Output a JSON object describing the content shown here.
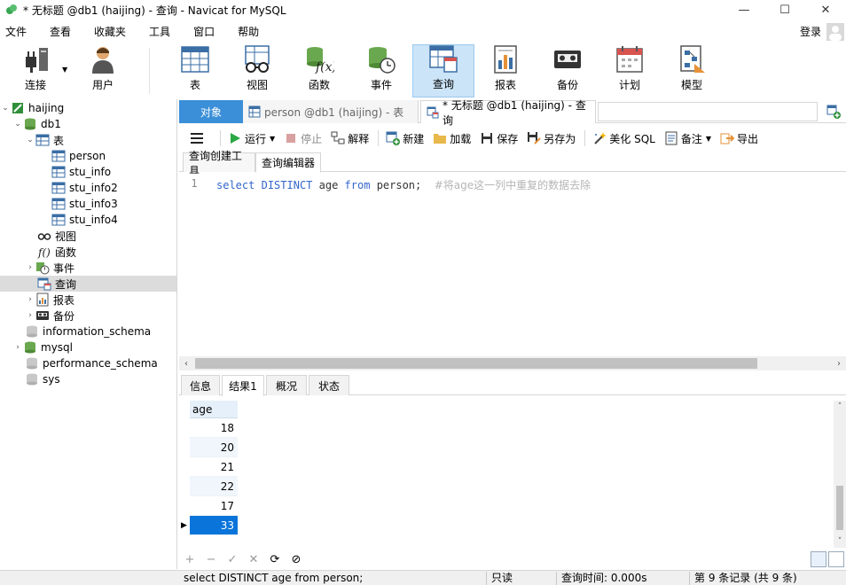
{
  "window": {
    "title": "* 无标题 @db1 (haijing) - 查询 - Navicat for MySQL",
    "minimize": "—",
    "maximize": "☐",
    "close": "✕"
  },
  "menu": {
    "items": [
      "文件",
      "查看",
      "收藏夹",
      "工具",
      "窗口",
      "帮助"
    ],
    "login": "登录"
  },
  "toolbar": {
    "connect": "连接",
    "user": "用户",
    "table": "表",
    "view": "视图",
    "function": "函数",
    "event": "事件",
    "query": "查询",
    "report": "报表",
    "backup": "备份",
    "schedule": "计划",
    "model": "模型"
  },
  "tree": {
    "connection": "haijing",
    "db": "db1",
    "tables_group": "表",
    "tables": [
      "person",
      "stu_info",
      "stu_info2",
      "stu_info3",
      "stu_info4"
    ],
    "views": "视图",
    "functions": "函数",
    "events": "事件",
    "queries": "查询",
    "reports": "报表",
    "backups": "备份",
    "schemas": [
      "information_schema",
      "mysql",
      "performance_schema",
      "sys"
    ]
  },
  "tabs": {
    "objects": "对象",
    "person": "person @db1 (haijing) - 表",
    "query": "* 无标题 @db1 (haijing) - 查询"
  },
  "qtoolbar": {
    "run": "运行",
    "stop": "停止",
    "explain": "解释",
    "new": "新建",
    "load": "加载",
    "save": "保存",
    "save_as": "另存为",
    "beautify": "美化 SQL",
    "note": "备注",
    "export": "导出"
  },
  "subtabs": {
    "builder": "查询创建工具",
    "editor": "查询编辑器"
  },
  "editor": {
    "line": "1",
    "kw_select": "select",
    "kw_distinct": "DISTINCT",
    "col": "age",
    "kw_from": "from",
    "table": "person;",
    "comment": "#将age这一列中重复的数据去除"
  },
  "result_tabs": [
    "信息",
    "结果1",
    "概况",
    "状态"
  ],
  "grid": {
    "header": "age",
    "values": [
      "18",
      "20",
      "21",
      "22",
      "17",
      "33"
    ]
  },
  "status": {
    "sql": "select DISTINCT age from person;",
    "mode": "只读",
    "time": "查询时间: 0.000s",
    "records": "第 9 条记录 (共 9 条)"
  },
  "colors": {
    "accent": "#3a8fd8",
    "selected_row": "#0a74da",
    "keyword": "#3366cc",
    "comment": "#b5b5b5"
  }
}
